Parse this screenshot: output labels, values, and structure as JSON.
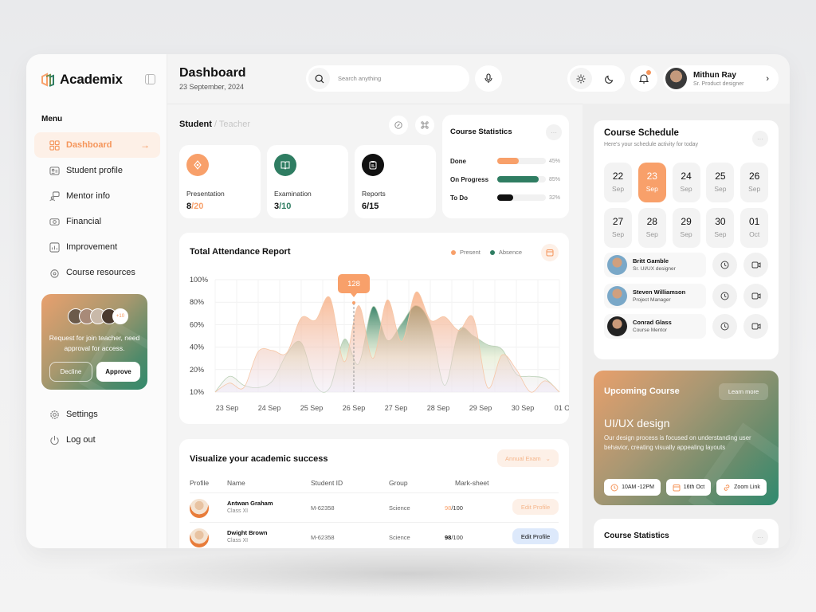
{
  "app": {
    "name": "Academix"
  },
  "sidebar": {
    "menu_label": "Menu",
    "items": [
      {
        "label": "Dashboard",
        "icon": "grid-icon",
        "active": true
      },
      {
        "label": "Student profile",
        "icon": "id-card-icon"
      },
      {
        "label": "Mentor info",
        "icon": "chat-user-icon"
      },
      {
        "label": "Financial",
        "icon": "money-icon"
      },
      {
        "label": "Improvement",
        "icon": "chart-icon"
      },
      {
        "label": "Course resources",
        "icon": "resource-icon"
      }
    ],
    "request_card": {
      "text": "Request for join teacher, need approval for access.",
      "more_count": "+10",
      "decline_label": "Decline",
      "approve_label": "Approve"
    },
    "bottom_items": [
      {
        "label": "Settings",
        "icon": "gear-icon"
      },
      {
        "label": "Log out",
        "icon": "logout-icon"
      }
    ]
  },
  "header": {
    "title": "Dashboard",
    "date": "23 September, 2024",
    "search_placeholder": "Search anything",
    "user": {
      "name": "Mithun Ray",
      "role": "Sr. Product designer"
    }
  },
  "student": {
    "title": "Student",
    "alt": " / Teacher",
    "cards": [
      {
        "label": "Presentation",
        "value": "8",
        "total": "/20",
        "color": "#f8a06a",
        "icon": "presentation-icon"
      },
      {
        "label": "Examination",
        "value": "3",
        "total": "/10",
        "color": "#2f7d62",
        "icon": "book-icon"
      },
      {
        "label": "Reports",
        "value": "6",
        "total": "/15",
        "color": "#111111",
        "icon": "clipboard-icon"
      }
    ]
  },
  "course_stats": {
    "title": "Course Statistics",
    "rows": [
      {
        "label": "Done",
        "percent": 45,
        "display": "45%",
        "color": "#f8a06a"
      },
      {
        "label": "On Progress",
        "percent": 85,
        "display": "85%",
        "color": "#2f7d62"
      },
      {
        "label": "To Do",
        "percent": 32,
        "display": "32%",
        "color": "#111111"
      }
    ]
  },
  "chart_data": {
    "type": "area",
    "title": "Total Attendance Report",
    "legend": [
      {
        "name": "Present",
        "color": "#f8a06a"
      },
      {
        "name": "Absence",
        "color": "#2f7d62"
      }
    ],
    "legend_position": "top-right",
    "y_ticks": [
      "100%",
      "80%",
      "60%",
      "40%",
      "20%",
      "10%"
    ],
    "categories": [
      "23 Sep",
      "24 Sep",
      "25 Sep",
      "26 Sep",
      "27 Sep",
      "28 Sep",
      "29 Sep",
      "30 Sep",
      "01 Oct"
    ],
    "tooltip": {
      "label": "128",
      "at": "26 Sep"
    },
    "series": [
      {
        "name": "Present",
        "values": [
          10,
          14,
          12,
          36,
          37,
          35,
          66,
          64,
          84,
          27,
          77,
          30,
          82,
          45,
          89,
          64,
          67,
          55,
          66,
          12,
          33,
          20,
          10,
          15,
          10
        ]
      },
      {
        "name": "Absence",
        "values": [
          10,
          17,
          13,
          12,
          15,
          34,
          44,
          13,
          12,
          47,
          25,
          76,
          46,
          61,
          77,
          60,
          13,
          55,
          50,
          42,
          38,
          18,
          17,
          16,
          10
        ]
      }
    ],
    "ylim": [
      10,
      100
    ],
    "grid": true
  },
  "table": {
    "title": "Visualize your academic success",
    "filter": "Annual Exam",
    "headers": [
      "Profile",
      "Name",
      "Student ID",
      "Group",
      "Mark-sheet"
    ],
    "rows": [
      {
        "name": "Antwan Graham",
        "class": "Class XI",
        "id": "M-62358",
        "group": "Science",
        "mark": "98",
        "total": "/100",
        "action": "Edit Profile",
        "style": "soft"
      },
      {
        "name": "Dwight Brown",
        "class": "Class XI",
        "id": "M-62358",
        "group": "Science",
        "mark": "98",
        "total": "/100",
        "action": "Edit Profile",
        "style": "active"
      }
    ]
  },
  "schedule": {
    "title": "Course Schedule",
    "subtitle": "Here's your schedule activity for today",
    "days": [
      {
        "d": "22",
        "m": "Sep"
      },
      {
        "d": "23",
        "m": "Sep",
        "selected": true
      },
      {
        "d": "24",
        "m": "Sep"
      },
      {
        "d": "25",
        "m": "Sep"
      },
      {
        "d": "26",
        "m": "Sep"
      },
      {
        "d": "27",
        "m": "Sep"
      },
      {
        "d": "28",
        "m": "Sep"
      },
      {
        "d": "29",
        "m": "Sep"
      },
      {
        "d": "30",
        "m": "Sep"
      },
      {
        "d": "01",
        "m": "Oct"
      }
    ],
    "mentors": [
      {
        "name": "Britt Gamble",
        "role": "Sr. UI/UX designer"
      },
      {
        "name": "Steven Williamson",
        "role": "Project Manager"
      },
      {
        "name": "Conrad Glass",
        "role": "Course Mentor"
      }
    ]
  },
  "upcoming": {
    "title": "Upcoming Course",
    "learn_more": "Learn more",
    "course": "UI/UX design",
    "description": "Our design process is focused on understanding user behavior, creating visually appealing layouts",
    "time": "10AM -12PM",
    "date": "16th Oct",
    "link": "Zoom Link"
  },
  "course_stats_2": {
    "title": "Course Statistics"
  }
}
